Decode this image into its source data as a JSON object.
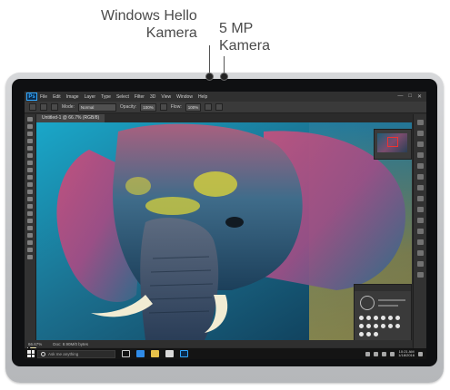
{
  "callouts": {
    "hello_line1": "Windows Hello",
    "hello_line2": "Kamera",
    "mp_line1": "5 MP",
    "mp_line2": "Kamera"
  },
  "app": {
    "logo": "Ps",
    "menu": [
      "File",
      "Edit",
      "Image",
      "Layer",
      "Type",
      "Select",
      "Filter",
      "3D",
      "View",
      "Window",
      "Help"
    ],
    "window_controls": [
      "—",
      "□",
      "✕"
    ],
    "options": {
      "mode_label": "Mode:",
      "mode_value": "Normal",
      "opacity_label": "Opacity:",
      "opacity_value": "100%",
      "flow_label": "Flow:",
      "flow_value": "100%"
    },
    "document_tab": "Untitled-1 @ 66.7% (RGB/8)",
    "status": {
      "zoom": "66.67%",
      "doc_info": "Doc: 8.90M/0 bytes"
    }
  },
  "taskbar": {
    "search_placeholder": "Ask me anything",
    "time": "10:21 AM",
    "date": "1/18/2016"
  },
  "colors": {
    "accent_photoshop": "#31a8ff",
    "callout_text": "#4a4a4a",
    "device_frame": "#c8cacc"
  },
  "icons": [
    "windows-start-icon",
    "search-icon",
    "task-view-icon",
    "edge-icon",
    "file-explorer-icon",
    "store-icon",
    "photoshop-icon",
    "brush-tool-icon",
    "move-tool-icon"
  ]
}
